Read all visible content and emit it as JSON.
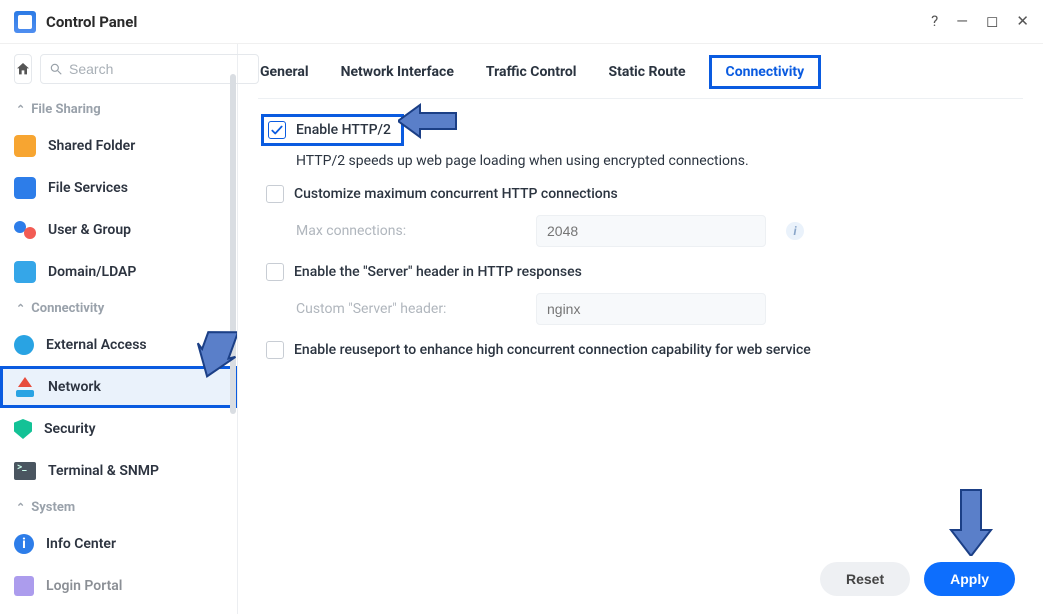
{
  "titlebar": {
    "title": "Control Panel"
  },
  "search": {
    "placeholder": "Search"
  },
  "sidebar": {
    "sections": {
      "file_sharing": "File Sharing",
      "connectivity": "Connectivity",
      "system": "System"
    },
    "items": {
      "shared_folder": "Shared Folder",
      "file_services": "File Services",
      "user_group": "User & Group",
      "domain_ldap": "Domain/LDAP",
      "external_access": "External Access",
      "network": "Network",
      "security": "Security",
      "terminal_snmp": "Terminal & SNMP",
      "info_center": "Info Center",
      "login_portal": "Login Portal"
    }
  },
  "tabs": {
    "general": "General",
    "network_interface": "Network Interface",
    "traffic_control": "Traffic Control",
    "static_route": "Static Route",
    "connectivity": "Connectivity"
  },
  "panel": {
    "enable_http2": "Enable HTTP/2",
    "http2_desc": "HTTP/2 speeds up web page loading when using encrypted connections.",
    "customize_max_conn": "Customize maximum concurrent HTTP connections",
    "max_conn_label": "Max connections:",
    "max_conn_placeholder": "2048",
    "enable_server_header": "Enable the \"Server\" header in HTTP responses",
    "custom_server_label": "Custom \"Server\" header:",
    "custom_server_placeholder": "nginx",
    "enable_reuseport": "Enable reuseport to enhance high concurrent connection capability for web service"
  },
  "footer": {
    "reset": "Reset",
    "apply": "Apply"
  },
  "colors": {
    "accent": "#0a5be0",
    "primary_btn": "#0d6efd"
  }
}
